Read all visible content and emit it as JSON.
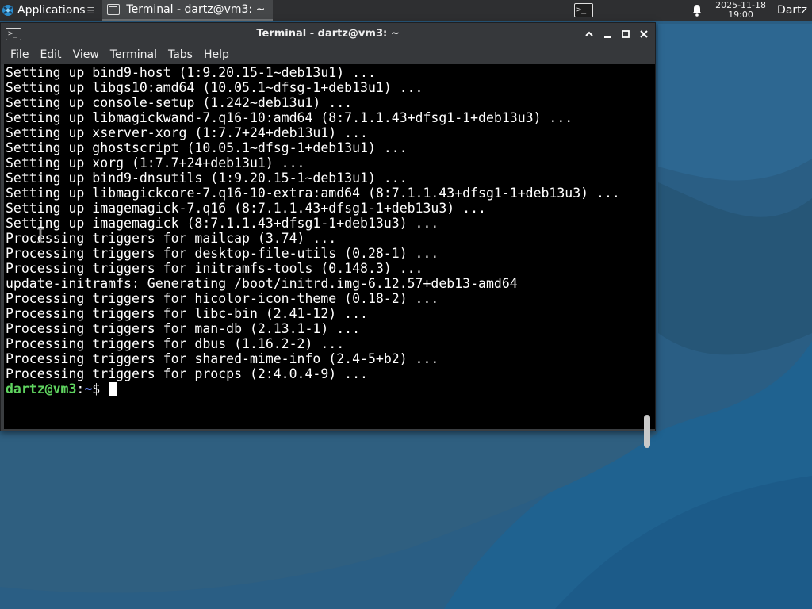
{
  "panel": {
    "applications_label": "Applications",
    "applications_more": "☰",
    "task_label": "Terminal - dartz@vm3: ~",
    "clock_date": "2025-11-18",
    "clock_time": "19:00",
    "user": "Dartz"
  },
  "window": {
    "title": "Terminal - dartz@vm3: ~",
    "icon_text": ">_",
    "menu": [
      "File",
      "Edit",
      "View",
      "Terminal",
      "Tabs",
      "Help"
    ]
  },
  "terminal": {
    "lines": [
      "Setting up bind9-host (1:9.20.15-1~deb13u1) ...",
      "Setting up libgs10:amd64 (10.05.1~dfsg-1+deb13u1) ...",
      "Setting up console-setup (1.242~deb13u1) ...",
      "Setting up libmagickwand-7.q16-10:amd64 (8:7.1.1.43+dfsg1-1+deb13u3) ...",
      "Setting up xserver-xorg (1:7.7+24+deb13u1) ...",
      "Setting up ghostscript (10.05.1~dfsg-1+deb13u1) ...",
      "Setting up xorg (1:7.7+24+deb13u1) ...",
      "Setting up bind9-dnsutils (1:9.20.15-1~deb13u1) ...",
      "Setting up libmagickcore-7.q16-10-extra:amd64 (8:7.1.1.43+dfsg1-1+deb13u3) ...",
      "Setting up imagemagick-7.q16 (8:7.1.1.43+dfsg1-1+deb13u3) ...",
      "Setting up imagemagick (8:7.1.1.43+dfsg1-1+deb13u3) ...",
      "Processing triggers for mailcap (3.74) ...",
      "Processing triggers for desktop-file-utils (0.28-1) ...",
      "Processing triggers for initramfs-tools (0.148.3) ...",
      "update-initramfs: Generating /boot/initrd.img-6.12.57+deb13-amd64",
      "Processing triggers for hicolor-icon-theme (0.18-2) ...",
      "Processing triggers for libc-bin (2.41-12) ...",
      "Processing triggers for man-db (2.13.1-1) ...",
      "Processing triggers for dbus (1.16.2-2) ...",
      "Processing triggers for shared-mime-info (2.4-5+b2) ...",
      "Processing triggers for procps (2:4.0.4-9) ..."
    ],
    "prompt_user": "dartz@vm3",
    "prompt_sep": ":",
    "prompt_dir": "~",
    "prompt_symbol": "$ "
  },
  "colors": {
    "panel_bg": "#2e2f31",
    "titlebar_bg": "#36383b",
    "terminal_bg": "#000000",
    "terminal_fg": "#ffffff",
    "prompt_user": "#5fd35f",
    "prompt_dir": "#6f8cff",
    "desktop": "#2b5d82"
  },
  "icons": {
    "applications": "xfce-logo-icon",
    "task": "terminal-icon",
    "tray_terminal": "terminal-icon",
    "notifications": "bell-icon",
    "window": "terminal-icon",
    "maximize": "maximize-icon",
    "minimize": "minimize-icon",
    "restore": "restore-icon",
    "close": "close-icon"
  }
}
